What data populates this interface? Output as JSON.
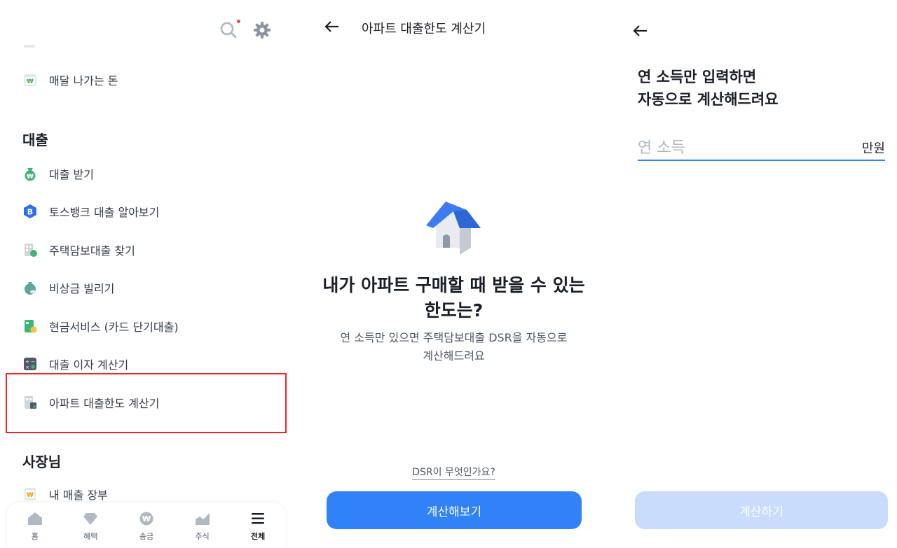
{
  "panel1": {
    "items_top": [
      {
        "label": "매달 나가는 돈",
        "icon": "calendar-won-icon"
      }
    ],
    "section_loan": "대출",
    "loan_items": [
      {
        "label": "대출 받기",
        "icon": "money-bag-icon"
      },
      {
        "label": "토스뱅크 대출 알아보기",
        "icon": "tossbank-b-icon"
      },
      {
        "label": "주택담보대출 찾기",
        "icon": "building-coin-icon"
      },
      {
        "label": "비상금 빌리기",
        "icon": "coin-bag-icon"
      },
      {
        "label": "현금서비스 (카드 단기대출)",
        "icon": "card-coin-icon"
      },
      {
        "label": "대출 이자 계산기",
        "icon": "calculator-icon"
      },
      {
        "label": "아파트 대출한도 계산기",
        "icon": "apartment-calculator-icon"
      }
    ],
    "section_owner": "사장님",
    "owner_items": [
      {
        "label": "내 매출 장부",
        "icon": "ledger-won-icon"
      }
    ],
    "nav": [
      {
        "label": "홈",
        "icon": "home-icon"
      },
      {
        "label": "혜택",
        "icon": "diamond-icon"
      },
      {
        "label": "송금",
        "icon": "won-coin-icon"
      },
      {
        "label": "주식",
        "icon": "chart-icon"
      },
      {
        "label": "전체",
        "icon": "menu-icon"
      }
    ],
    "colors": {
      "highlight": "#e8262d",
      "notification": "#f04452"
    }
  },
  "panel2": {
    "title": "아파트 대출한도 계산기",
    "headline_line1": "내가 아파트 구매할 때 받을 수 있는",
    "headline_line2": "한도는?",
    "sub_line1": "연 소득만 있으면 주택담보대출 DSR을 자동으로",
    "sub_line2": "계산해드려요",
    "dsr_link": "DSR이 무엇인가요?",
    "button": "계산해보기",
    "colors": {
      "primary": "#3182f6"
    }
  },
  "panel3": {
    "heading_line1": "연 소득만 입력하면",
    "heading_line2": "자동으로 계산해드려요",
    "input_placeholder": "연 소득",
    "input_value": "",
    "unit": "만원",
    "button": "계산하기",
    "colors": {
      "disabled_button": "#c9dcfb"
    }
  }
}
